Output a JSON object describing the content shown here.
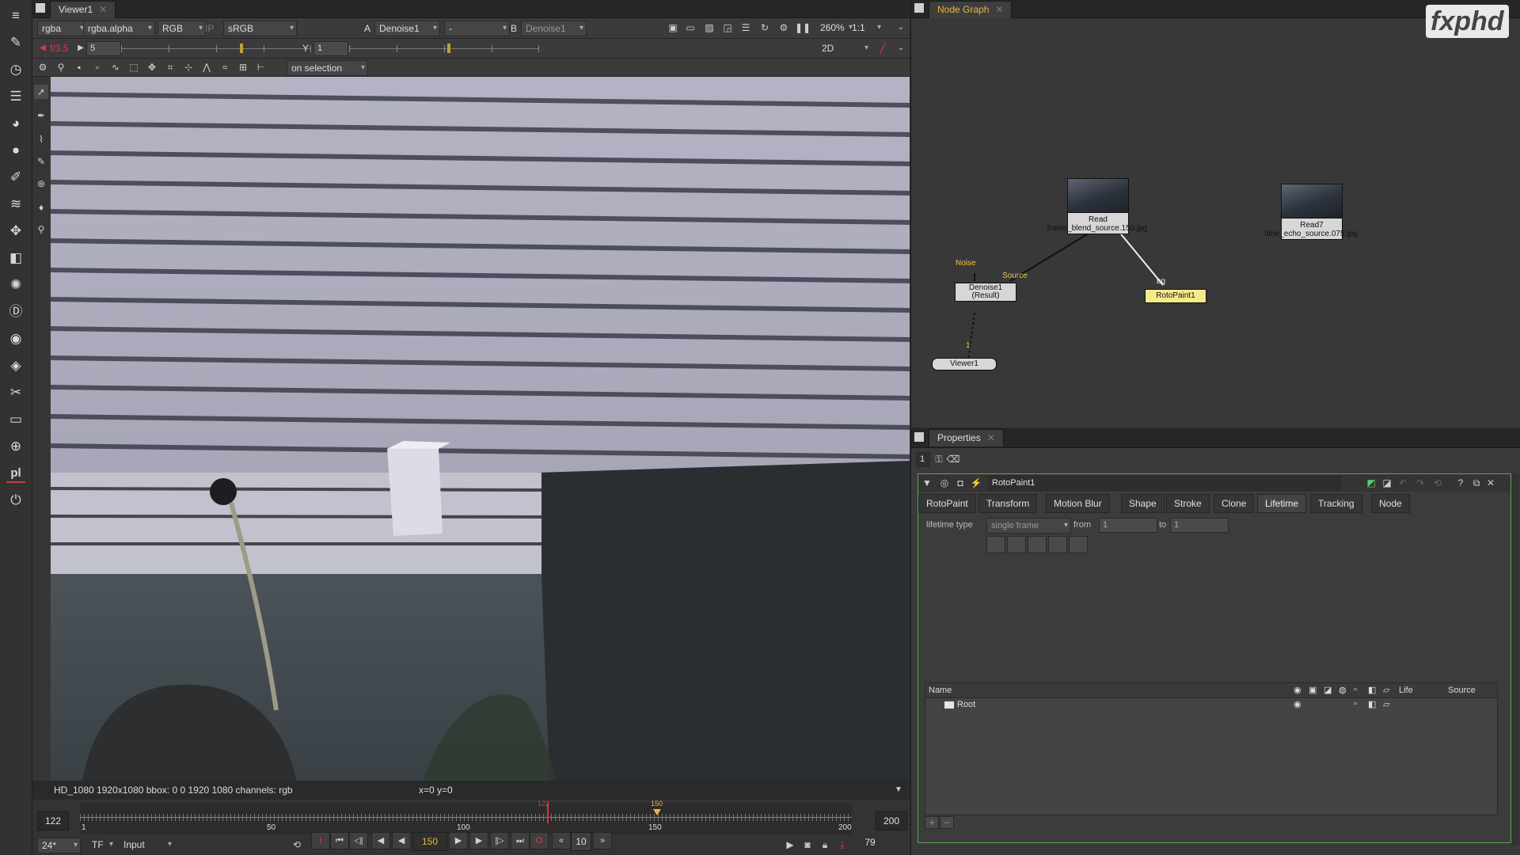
{
  "left_toolbar": {
    "icons": [
      "menu-icon",
      "pencil-icon",
      "clock-icon",
      "layers-icon",
      "color-wheel-icon",
      "circle-icon",
      "brush-icon",
      "stack-icon",
      "move-icon",
      "cube-icon",
      "particles-icon",
      "d-icon",
      "eye-icon",
      "tag-icon",
      "wrench-icon",
      "layer-icon",
      "globe-icon",
      "pl-icon",
      "power-icon"
    ],
    "pl_label": "pl"
  },
  "viewer": {
    "tab_label": "Viewer1",
    "layer": "rgba",
    "channel": "rgba.alpha",
    "display": "RGB",
    "ip": "IP",
    "lut": "sRGB",
    "input_a_label": "A",
    "input_a": "Denoise1",
    "input_a_op": "-",
    "input_b_label": "B",
    "input_b": "Denoise1",
    "zoom": "260%",
    "ratio": "1:1",
    "gain_label": "f/3.5",
    "gain_value": "5",
    "gamma_label": "Y",
    "gamma_value": "1",
    "view_mode": "2D",
    "selection_dropdown": "on selection",
    "info_format": "HD_1080 1920x1080  bbox: 0 0 1920 1080 channels: rgb",
    "info_coords": "x=0 y=0"
  },
  "timeline": {
    "in_frame": "122",
    "out_frame": "200",
    "ticks": [
      "1",
      "50",
      "100",
      "150",
      "200"
    ],
    "playhead_label": "122",
    "marker_label": "150",
    "fps": "24*",
    "tf": "TF",
    "mode": "Input",
    "current_frame": "150",
    "step": "10",
    "end_value": "79",
    "playhead_fraction": 0.605,
    "marker_fraction": 0.748
  },
  "node_graph": {
    "tab_label": "Node Graph",
    "watermark": "fxphd",
    "nodes": {
      "read_a_title": "Read",
      "read_a_file": "frame_blend_source.150.jpg",
      "read_b_title": "Read7",
      "read_b_file": "time_echo_source.075.jpg",
      "denoise_title": "Denoise1",
      "denoise_sub": "(Result)",
      "roto_title": "RotoPaint1",
      "viewer_title": "Viewer1",
      "noise_label": "Noise",
      "source_label": "Source",
      "bg_label": "bg",
      "viewer_input": "1"
    }
  },
  "properties": {
    "tab_label": "Properties",
    "count": "1",
    "node_name": "RotoPaint1",
    "tabs": [
      "RotoPaint",
      "Transform",
      "Motion Blur",
      "Shape",
      "Stroke",
      "Clone",
      "Lifetime",
      "Tracking",
      "Node"
    ],
    "active_tab": "Lifetime",
    "lifetime_type_label": "lifetime type",
    "lifetime_type_value": "single frame",
    "from_label": "from",
    "from_value": "1",
    "to_label": "to",
    "to_value": "1",
    "columns": [
      "Name",
      "Life",
      "Source"
    ],
    "root_item": "Root",
    "help": "?"
  }
}
